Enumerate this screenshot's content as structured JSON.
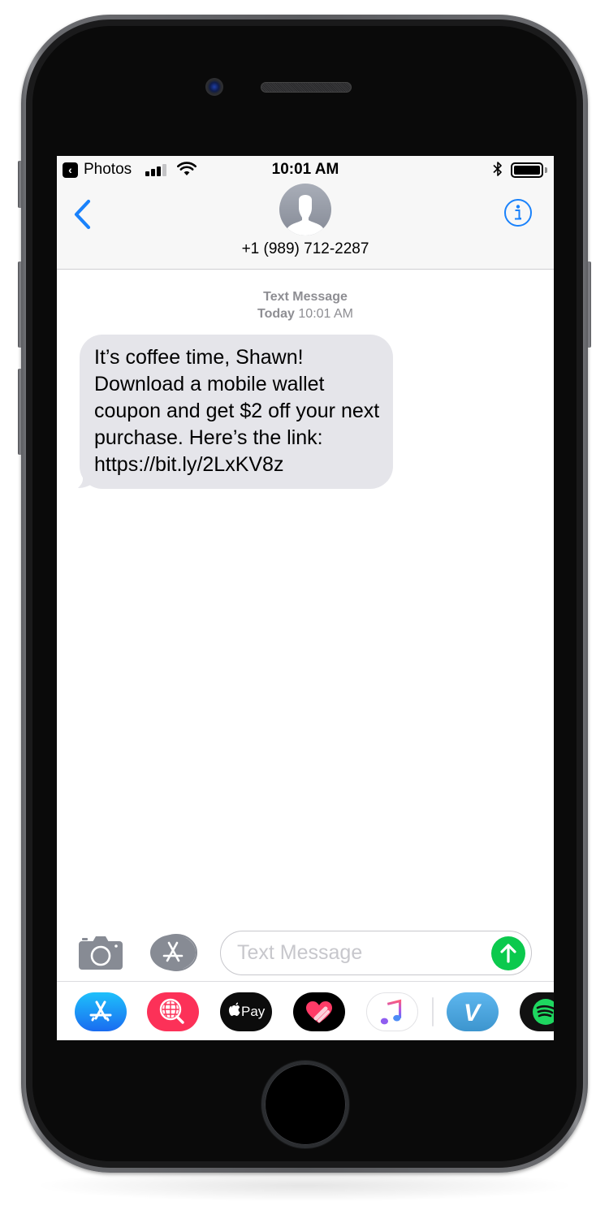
{
  "status_bar": {
    "back_app": "Photos",
    "time": "10:01 AM",
    "signal_bars_filled": 3,
    "signal_bars_total": 4,
    "wifi": "wifi-icon",
    "bluetooth": "bluetooth-icon",
    "battery_level": 1.0
  },
  "header": {
    "back_icon": "chevron-left-icon",
    "avatar_icon": "person-silhouette-icon",
    "contact": "+1 (989) 712-2287",
    "info_icon": "info-circle-icon"
  },
  "conversation": {
    "service_label": "Text Message",
    "date_label": "Today",
    "time_label": "10:01 AM",
    "messages": [
      {
        "direction": "incoming",
        "text": "It’s coffee time, Shawn! Download a mobile wallet coupon and get $2 off your next purchase. Here’s the link: https://bit.ly/2LxKV8z"
      }
    ]
  },
  "composer": {
    "camera_icon": "camera-icon",
    "apps_icon": "app-store-icon",
    "placeholder": "Text Message",
    "value": "",
    "send_icon": "arrow-up-icon",
    "send_color": "#0bc94d"
  },
  "app_drawer": {
    "apps": [
      {
        "name": "App Store",
        "icon": "app-store-icon",
        "color": "#1a8cf5"
      },
      {
        "name": "Images Search",
        "icon": "globe-search-icon",
        "color": "#fc3158"
      },
      {
        "name": "Apple Pay",
        "icon": "apple-pay-icon",
        "label": "Pay",
        "color": "#000000"
      },
      {
        "name": "Digital Touch",
        "icon": "heart-touch-icon",
        "color": "#000000"
      },
      {
        "name": "Music",
        "icon": "music-note-icon",
        "color": "#ffffff"
      },
      {
        "name": "Venmo",
        "icon": "venmo-icon",
        "label": "V",
        "color": "#3d95ce"
      },
      {
        "name": "Spotify",
        "icon": "spotify-icon",
        "color": "#1ed760"
      }
    ]
  },
  "colors": {
    "ios_blue": "#1a82fb",
    "bubble_gray": "#e5e5ea",
    "meta_gray": "#8e8e93"
  }
}
